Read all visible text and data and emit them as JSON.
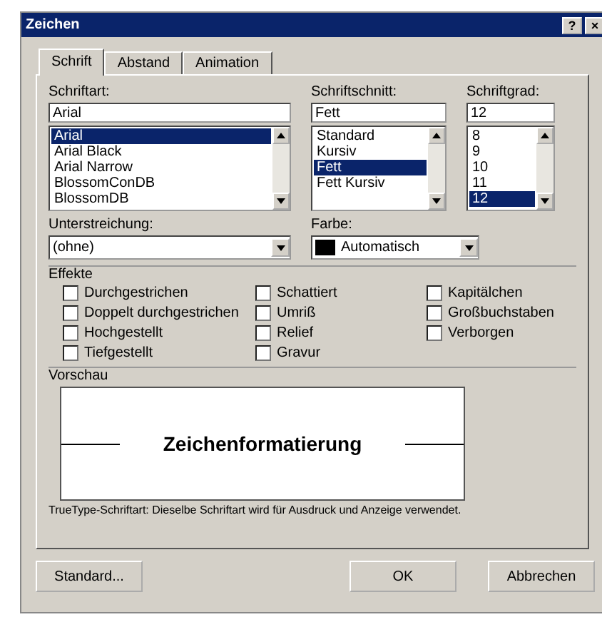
{
  "window": {
    "title": "Zeichen",
    "buttons": [
      "?",
      "×"
    ]
  },
  "tabs": [
    {
      "label": "Schrift",
      "selected": true
    },
    {
      "label": "Abstand",
      "selected": false
    },
    {
      "label": "Animation",
      "selected": false
    }
  ],
  "font": {
    "label": "Schriftart:",
    "value": "Arial",
    "items": [
      {
        "label": "Arial",
        "selected": true
      },
      {
        "label": "Arial Black",
        "selected": false
      },
      {
        "label": "Arial Narrow",
        "selected": false
      },
      {
        "label": "BlossomConDB",
        "selected": false
      },
      {
        "label": "BlossomDB",
        "selected": false
      }
    ]
  },
  "style": {
    "label": "Schriftschnitt:",
    "value": "Fett",
    "items": [
      {
        "label": "Standard",
        "selected": false
      },
      {
        "label": "Kursiv",
        "selected": false
      },
      {
        "label": "Fett",
        "selected": true
      },
      {
        "label": "Fett Kursiv",
        "selected": false
      }
    ]
  },
  "size": {
    "label": "Schriftgrad:",
    "value": "12",
    "items": [
      {
        "label": "8",
        "selected": false
      },
      {
        "label": "9",
        "selected": false
      },
      {
        "label": "10",
        "selected": false
      },
      {
        "label": "11",
        "selected": false
      },
      {
        "label": "12",
        "selected": true
      }
    ]
  },
  "underline": {
    "label": "Unterstreichung:",
    "value": "(ohne)"
  },
  "color": {
    "label": "Farbe:",
    "value": "Automatisch"
  },
  "effects": {
    "label": "Effekte",
    "columns": [
      [
        {
          "label": "Durchgestrichen",
          "checked": false
        },
        {
          "label": "Doppelt durchgestrichen",
          "checked": false
        },
        {
          "label": "Hochgestellt",
          "checked": false
        },
        {
          "label": "Tiefgestellt",
          "checked": false
        }
      ],
      [
        {
          "label": "Schattiert",
          "checked": false
        },
        {
          "label": "Umriß",
          "checked": false
        },
        {
          "label": "Relief",
          "checked": false
        },
        {
          "label": "Gravur",
          "checked": false
        }
      ],
      [
        {
          "label": "Kapitälchen",
          "checked": false
        },
        {
          "label": "Großbuchstaben",
          "checked": false
        },
        {
          "label": "Verborgen",
          "checked": false
        }
      ]
    ]
  },
  "preview": {
    "label": "Vorschau",
    "sample": "Zeichenformatierung",
    "note": "TrueType-Schriftart: Dieselbe Schriftart wird für Ausdruck und Anzeige verwendet."
  },
  "buttons": [
    "Standard...",
    "OK",
    "Abbrechen"
  ]
}
